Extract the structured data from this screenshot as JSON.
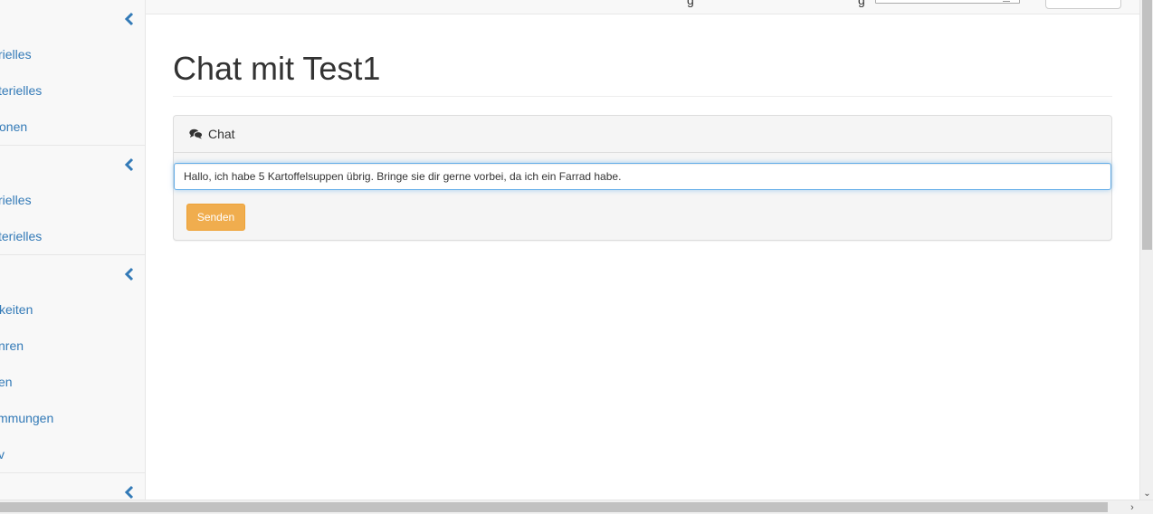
{
  "sidebar": {
    "sections": [
      {
        "items": [
          "rielles",
          "terielles",
          "onen"
        ]
      },
      {
        "items": [
          "rielles",
          "terielles"
        ]
      },
      {
        "items": [
          "keiten",
          "nren",
          "en",
          "mmungen",
          "v"
        ]
      },
      {
        "items": []
      }
    ]
  },
  "main": {
    "title": "Chat mit Test1",
    "panel": {
      "heading": "Chat",
      "input_value": "Hallo, ich habe 5 Kartoffelsuppen übrig. Bringe sie dir gerne vorbei, da ich ein Farrad habe.",
      "send_label": "Senden"
    }
  },
  "colors": {
    "link": "#337ab7",
    "warning_button": "#f0ad4e",
    "focus_border": "#66afe9"
  },
  "icons": {
    "sidebar_toggle": "chevron-left-icon",
    "chat_heading": "comments-icon",
    "scroll_down": "chevron-down-icon",
    "scroll_right": "chevron-right-icon"
  }
}
